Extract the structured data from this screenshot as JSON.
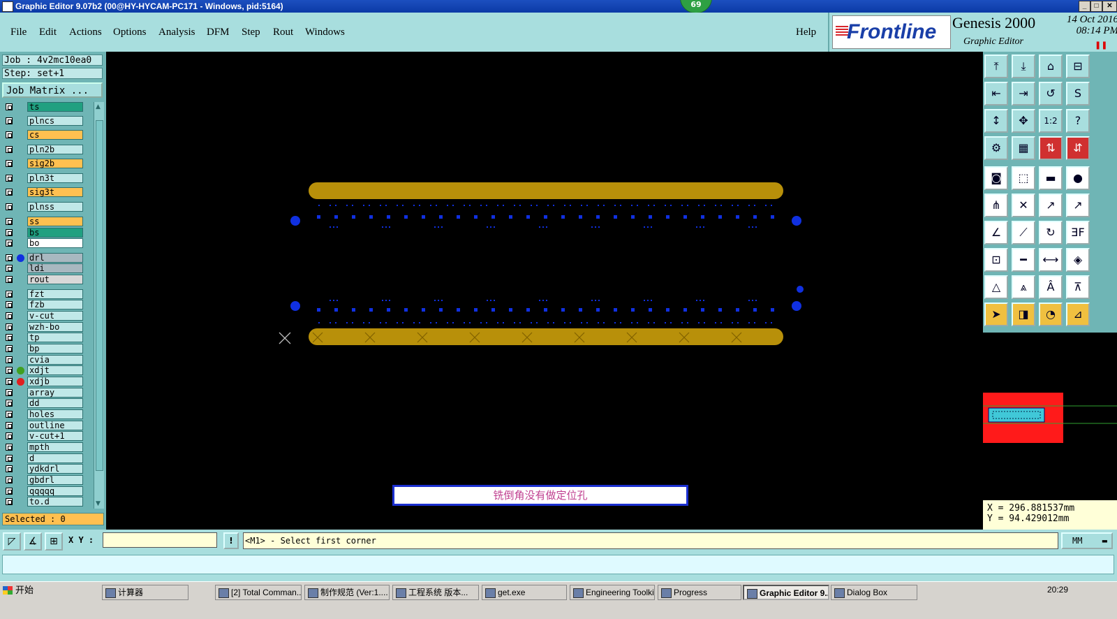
{
  "window": {
    "title": "Graphic Editor 9.07b2 (00@HY-HYCAM-PC171 - Windows, pid:5164)",
    "badge": "69"
  },
  "menu": [
    "File",
    "Edit",
    "Actions",
    "Options",
    "Analysis",
    "DFM",
    "Step",
    "Rout",
    "Windows"
  ],
  "help_label": "Help",
  "brand": {
    "logo": "Frontline",
    "product": "Genesis 2000",
    "subtitle": "Graphic Editor",
    "date": "14 Oct 2016",
    "time": "08:14 PM"
  },
  "job": {
    "job_line": "Job : 4v2mc10ea0",
    "step_line": "Step: set+1",
    "matrix_button": "Job Matrix ..."
  },
  "layers": [
    {
      "name": "ts",
      "color": "#20a080",
      "dot": ""
    },
    {
      "name": "plncs",
      "color": "#c0e8e8",
      "dot": ""
    },
    {
      "name": "cs",
      "color": "#ffc050",
      "dot": ""
    },
    {
      "name": "pln2b",
      "color": "#c0e8e8",
      "dot": ""
    },
    {
      "name": "sig2b",
      "color": "#ffc050",
      "dot": ""
    },
    {
      "name": "pln3t",
      "color": "#c0e8e8",
      "dot": ""
    },
    {
      "name": "sig3t",
      "color": "#ffc050",
      "dot": ""
    },
    {
      "name": "plnss",
      "color": "#c0e8e8",
      "dot": ""
    },
    {
      "name": "ss",
      "color": "#ffc050",
      "dot": ""
    },
    {
      "name": "bs",
      "color": "#20a080",
      "dot": ""
    },
    {
      "name": "bo",
      "color": "#ffffff",
      "dot": ""
    },
    {
      "name": "drl",
      "color": "#a8b8c0",
      "dot": "#1030e0"
    },
    {
      "name": "ldi",
      "color": "#a8b8c0",
      "dot": ""
    },
    {
      "name": "rout",
      "color": "#d8d8d8",
      "dot": ""
    },
    {
      "name": "fzt",
      "color": "#c0e8e8",
      "dot": ""
    },
    {
      "name": "fzb",
      "color": "#c0e8e8",
      "dot": ""
    },
    {
      "name": "v-cut",
      "color": "#c0e8e8",
      "dot": ""
    },
    {
      "name": "wzh-bo",
      "color": "#c0e8e8",
      "dot": ""
    },
    {
      "name": "tp",
      "color": "#c0e8e8",
      "dot": ""
    },
    {
      "name": "bp",
      "color": "#c0e8e8",
      "dot": ""
    },
    {
      "name": "cvia",
      "color": "#c0e8e8",
      "dot": ""
    },
    {
      "name": "xdjt",
      "color": "#c0e8e8",
      "dot": "#40a020"
    },
    {
      "name": "xdjb",
      "color": "#c0e8e8",
      "dot": "#e02020"
    },
    {
      "name": "array",
      "color": "#c0e8e8",
      "dot": ""
    },
    {
      "name": "dd",
      "color": "#c0e8e8",
      "dot": ""
    },
    {
      "name": "holes",
      "color": "#c0e8e8",
      "dot": ""
    },
    {
      "name": "outline",
      "color": "#c0e8e8",
      "dot": ""
    },
    {
      "name": "v-cut+1",
      "color": "#c0e8e8",
      "dot": ""
    },
    {
      "name": "mpth",
      "color": "#c0e8e8",
      "dot": ""
    },
    {
      "name": "d",
      "color": "#c0e8e8",
      "dot": ""
    },
    {
      "name": "ydkdrl",
      "color": "#c0e8e8",
      "dot": ""
    },
    {
      "name": "gbdrl",
      "color": "#c0e8e8",
      "dot": ""
    },
    {
      "name": "qqqqq",
      "color": "#c0e8e8",
      "dot": ""
    },
    {
      "name": "to.d",
      "color": "#c0e8e8",
      "dot": ""
    }
  ],
  "selected_text": "Selected : 0",
  "canvas_message": "铣倒角没有做定位孔",
  "colors": {
    "trace": "#b8900a",
    "pad": "#1030e0",
    "preview_board": "#ff1a1a",
    "preview_part": "#40c8d8"
  },
  "coords": {
    "x": "X = 296.881537mm",
    "y": "Y = 94.429012mm"
  },
  "command": {
    "xy_label": "X Y :",
    "xy_value": "",
    "prompt": "<M1> - Select first corner",
    "units": "MM"
  },
  "taskbar": {
    "start": "开始",
    "tasks": [
      "计算器",
      "[2] Total Comman...",
      "制作规范 (Ver:1....",
      "工程系统  版本...",
      "get.exe",
      "Engineering Toolki...",
      "Progress",
      "Graphic Editor 9...",
      "Dialog Box"
    ],
    "clock": "20:29"
  }
}
